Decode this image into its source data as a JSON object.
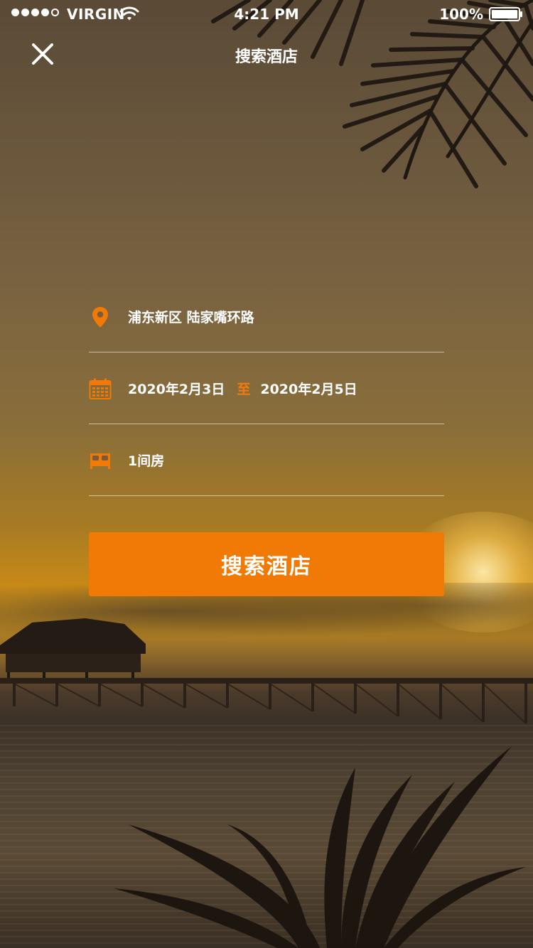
{
  "status_bar": {
    "carrier": "VIRGIN",
    "time": "4:21 PM",
    "battery": "100%"
  },
  "header": {
    "title": "搜索酒店",
    "close_icon": "close-icon"
  },
  "form": {
    "location": "浦东新区 陆家嘴环路",
    "check_in": "2020年2月3日",
    "date_separator": "至",
    "check_out": "2020年2月5日",
    "rooms": "1间房"
  },
  "search_button_label": "搜索酒店",
  "colors": {
    "accent": "#f07a05"
  },
  "icons": {
    "location": "location-pin-icon",
    "date": "calendar-icon",
    "rooms": "bed-icon",
    "wifi": "wifi-icon",
    "battery": "battery-icon"
  }
}
